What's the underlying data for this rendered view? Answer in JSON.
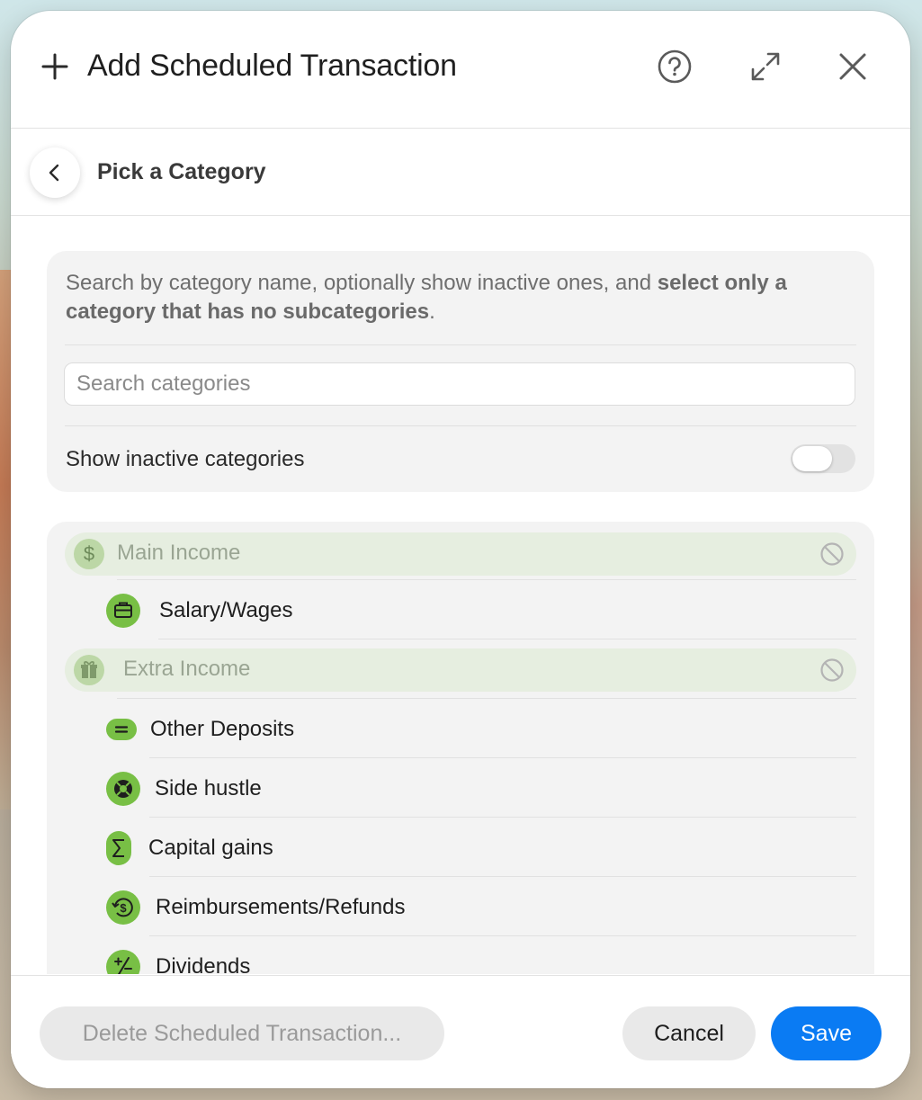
{
  "dialog": {
    "title": "Add Scheduled Transaction",
    "icons": {
      "add": "plus-icon",
      "help": "question-circle-icon",
      "expand": "expand-arrows-icon",
      "close": "close-icon"
    }
  },
  "subheader": {
    "title": "Pick a Category",
    "back_icon": "chevron-left-icon"
  },
  "filter": {
    "description_prefix": "Search by category name, optionally show inactive ones, and ",
    "description_bold": "select only a category that has no subcategories",
    "description_suffix": ".",
    "search_placeholder": "Search categories",
    "search_value": "",
    "show_inactive_label": "Show inactive categories",
    "show_inactive_on": false
  },
  "categories": {
    "groups": [
      {
        "label": "Main Income",
        "icon": "dollar-sign-icon",
        "selectable": false,
        "items": [
          {
            "label": "Salary/Wages",
            "icon": "briefcase-icon"
          }
        ]
      },
      {
        "label": "Extra Income",
        "icon": "gift-icon",
        "selectable": false,
        "items": [
          {
            "label": "Other Deposits",
            "icon": "equals-icon"
          },
          {
            "label": "Side hustle",
            "icon": "life-ring-icon"
          },
          {
            "label": "Capital gains",
            "icon": "sigma-icon"
          },
          {
            "label": "Reimbursements/Refunds",
            "icon": "refund-dollar-icon"
          },
          {
            "label": "Dividends",
            "icon": "plus-minus-icon"
          }
        ]
      }
    ],
    "colors": {
      "item_icon": "#78bf45",
      "group_bg": "#e6eee0",
      "group_icon_bg": "#bcd7a6"
    }
  },
  "footer": {
    "delete_label": "Delete Scheduled Transaction...",
    "cancel_label": "Cancel",
    "save_label": "Save",
    "save_color": "#0a7bf3"
  }
}
